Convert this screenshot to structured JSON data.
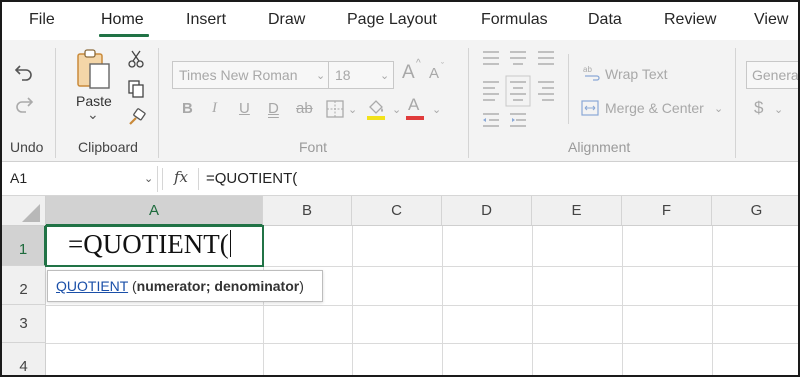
{
  "menu": {
    "tabs": [
      "File",
      "Home",
      "Insert",
      "Draw",
      "Page Layout",
      "Formulas",
      "Data",
      "Review",
      "View"
    ],
    "active_tab": "Home"
  },
  "ribbon": {
    "undo_group_label": "Undo",
    "clipboard": {
      "paste_label": "Paste",
      "paste_chevron": "⌄",
      "group_label": "Clipboard"
    },
    "font": {
      "font_name": "Times New Roman",
      "font_size": "18",
      "grow_label": "A",
      "shrink_label": "A",
      "bold_label": "B",
      "italic_label": "I",
      "underline_label": "U",
      "double_underline_label": "D",
      "strike_label": "ab",
      "font_color_label": "A",
      "group_label": "Font"
    },
    "alignment": {
      "wrap_text_label": "Wrap Text",
      "merge_center_label": "Merge & Center",
      "group_label": "Alignment"
    },
    "number": {
      "format_value": "General",
      "currency_symbol": "$"
    }
  },
  "formula_bar": {
    "name_box": "A1",
    "fx_label": "fx",
    "formula": "=QUOTIENT("
  },
  "grid": {
    "columns": [
      "A",
      "B",
      "C",
      "D",
      "E",
      "F",
      "G"
    ],
    "rows": [
      "1",
      "2",
      "3",
      "4"
    ],
    "active_cell_text": "=QUOTIENT(",
    "tooltip": {
      "function_name": "QUOTIENT",
      "open_paren": "(",
      "args": "numerator; denominator",
      "close_paren": ")"
    }
  },
  "colors": {
    "accent_green": "#217346",
    "link_blue": "#1a4fa8",
    "highlight_yellow": "#f2e21a",
    "font_red": "#e03b3b"
  }
}
